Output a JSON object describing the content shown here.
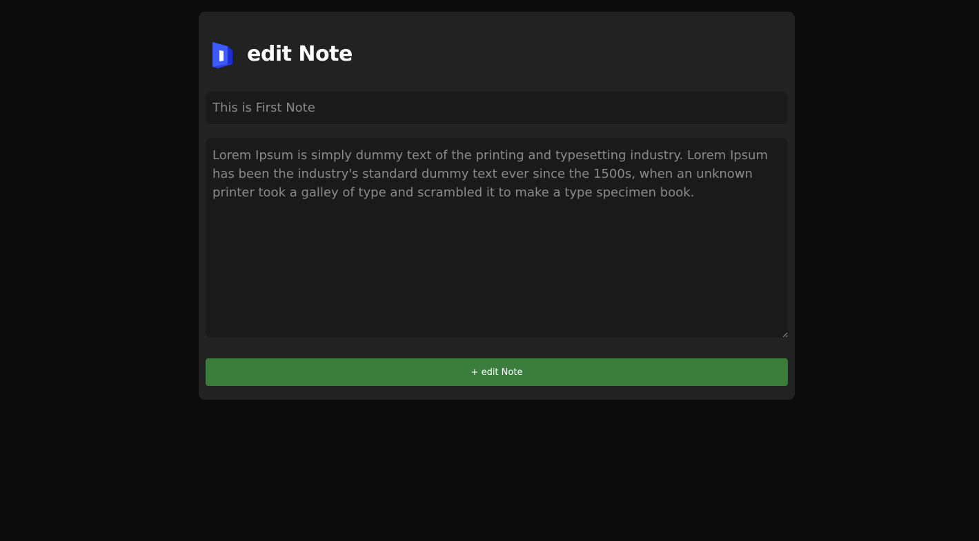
{
  "header": {
    "logo_icon": "brand-logo-icon",
    "title": "edit Note"
  },
  "form": {
    "title_value": "This is First Note",
    "body_value": "Lorem Ipsum is simply dummy text of the printing and typesetting industry. Lorem Ipsum has been the industry's standard dummy text ever since the 1500s, when an unknown printer took a galley of type and scrambled it to make a type specimen book.",
    "submit_label": "+ edit Note"
  },
  "colors": {
    "background": "#0b0b0b",
    "card": "#222222",
    "field": "#1a1a1a",
    "button": "#3a7d3c",
    "logo_primary": "#3d5afe",
    "logo_secondary": "#1e2fc9"
  }
}
